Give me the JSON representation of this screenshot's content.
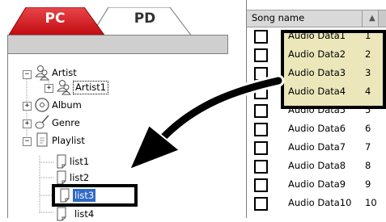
{
  "tabs": {
    "pc_label": "PC",
    "pd_label": "PD"
  },
  "tree": {
    "artist": "Artist",
    "artist1": "Artist1",
    "album": "Album",
    "genre": "Genre",
    "playlist": "Playlist",
    "list1": "list1",
    "list2": "list2",
    "list3": "list3",
    "list4": "list4"
  },
  "song_list": {
    "header_song_name": "Song name",
    "sort_icon": "triangle-up-icon",
    "rows": [
      {
        "name": "Audio Data1",
        "no": "1"
      },
      {
        "name": "Audio Data2",
        "no": "2"
      },
      {
        "name": "Audio Data3",
        "no": "3"
      },
      {
        "name": "Audio Data4",
        "no": "4"
      },
      {
        "name": "Audio Data5",
        "no": "5"
      },
      {
        "name": "Audio Data6",
        "no": "6"
      },
      {
        "name": "Audio Data7",
        "no": "7"
      },
      {
        "name": "Audio Data8",
        "no": "8"
      },
      {
        "name": "Audio Data9",
        "no": "9"
      },
      {
        "name": "Audio Data10",
        "no": "10"
      }
    ]
  },
  "colors": {
    "pc_tab": "#d0161b",
    "selection": "#316ac5",
    "highlight_rows": "#ebe7ba"
  }
}
